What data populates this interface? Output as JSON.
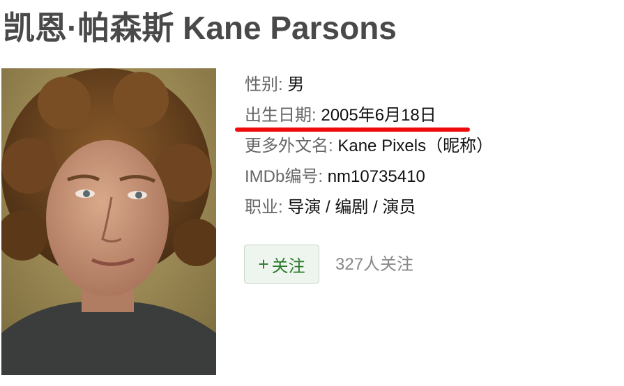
{
  "person": {
    "title": "凯恩·帕森斯 Kane Parsons",
    "photo_alt": "Kane Parsons"
  },
  "info": [
    {
      "key": "性别:",
      "value": "男"
    },
    {
      "key": "出生日期:",
      "value": "2005年6月18日"
    },
    {
      "key": "更多外文名:",
      "value": "Kane Pixels（昵称）"
    },
    {
      "key": "IMDb编号:",
      "value": "nm10735410"
    },
    {
      "key": "职业:",
      "value": "导演 / 编剧 / 演员"
    }
  ],
  "follow": {
    "icon": "+",
    "label": "关注",
    "count_text": "327人关注"
  },
  "colors": {
    "title": "#494949",
    "highlight": "#ee0b0b",
    "follow_text": "#2c7a2c"
  }
}
